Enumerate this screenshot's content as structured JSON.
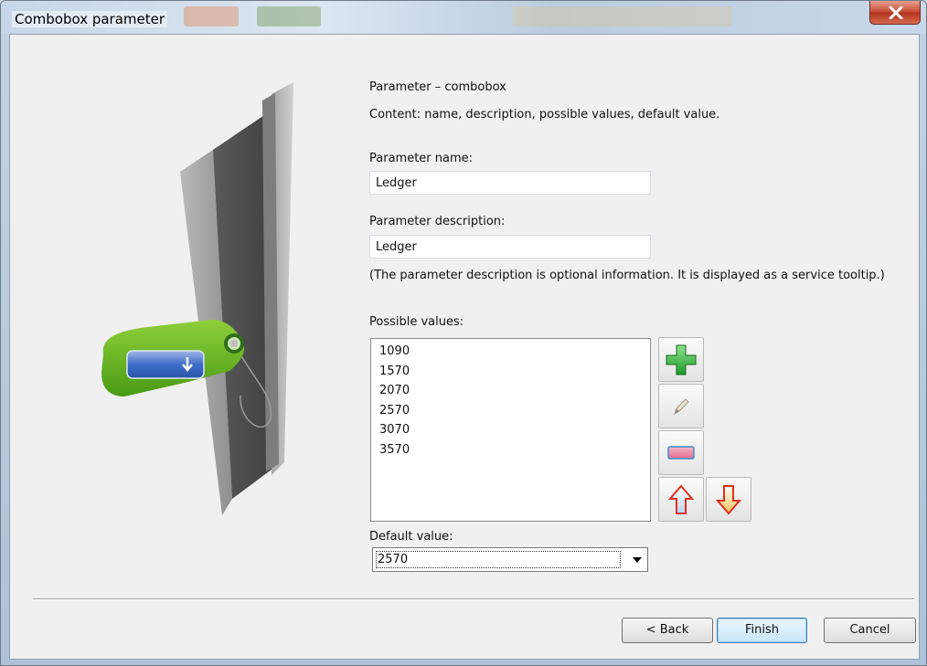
{
  "window": {
    "title": "Combobox parameter"
  },
  "header": {
    "heading": "Parameter – combobox",
    "content": "Content: name, description, possible values, default value."
  },
  "name_field": {
    "label": "Parameter name:",
    "value": "Ledger"
  },
  "description_field": {
    "label": "Parameter description:",
    "value": "Ledger",
    "note": "(The parameter description is optional information. It is displayed as a service tooltip.)"
  },
  "possible_values": {
    "label": "Possible values:",
    "items": [
      "1090",
      "1570",
      "2070",
      "2570",
      "3070",
      "3570"
    ]
  },
  "tools": {
    "add_icon": "plus-icon",
    "edit_icon": "pencil-icon",
    "delete_icon": "eraser-icon",
    "move_up_icon": "arrow-up-icon",
    "move_down_icon": "arrow-down-icon"
  },
  "default_value": {
    "label": "Default value:",
    "selected": "2570"
  },
  "buttons": {
    "back": "< Back",
    "finish": "Finish",
    "cancel": "Cancel"
  },
  "colors": {
    "accent": "#3c7fb1",
    "close_button": "#c7462f",
    "tag_green": "#5fae1f"
  }
}
